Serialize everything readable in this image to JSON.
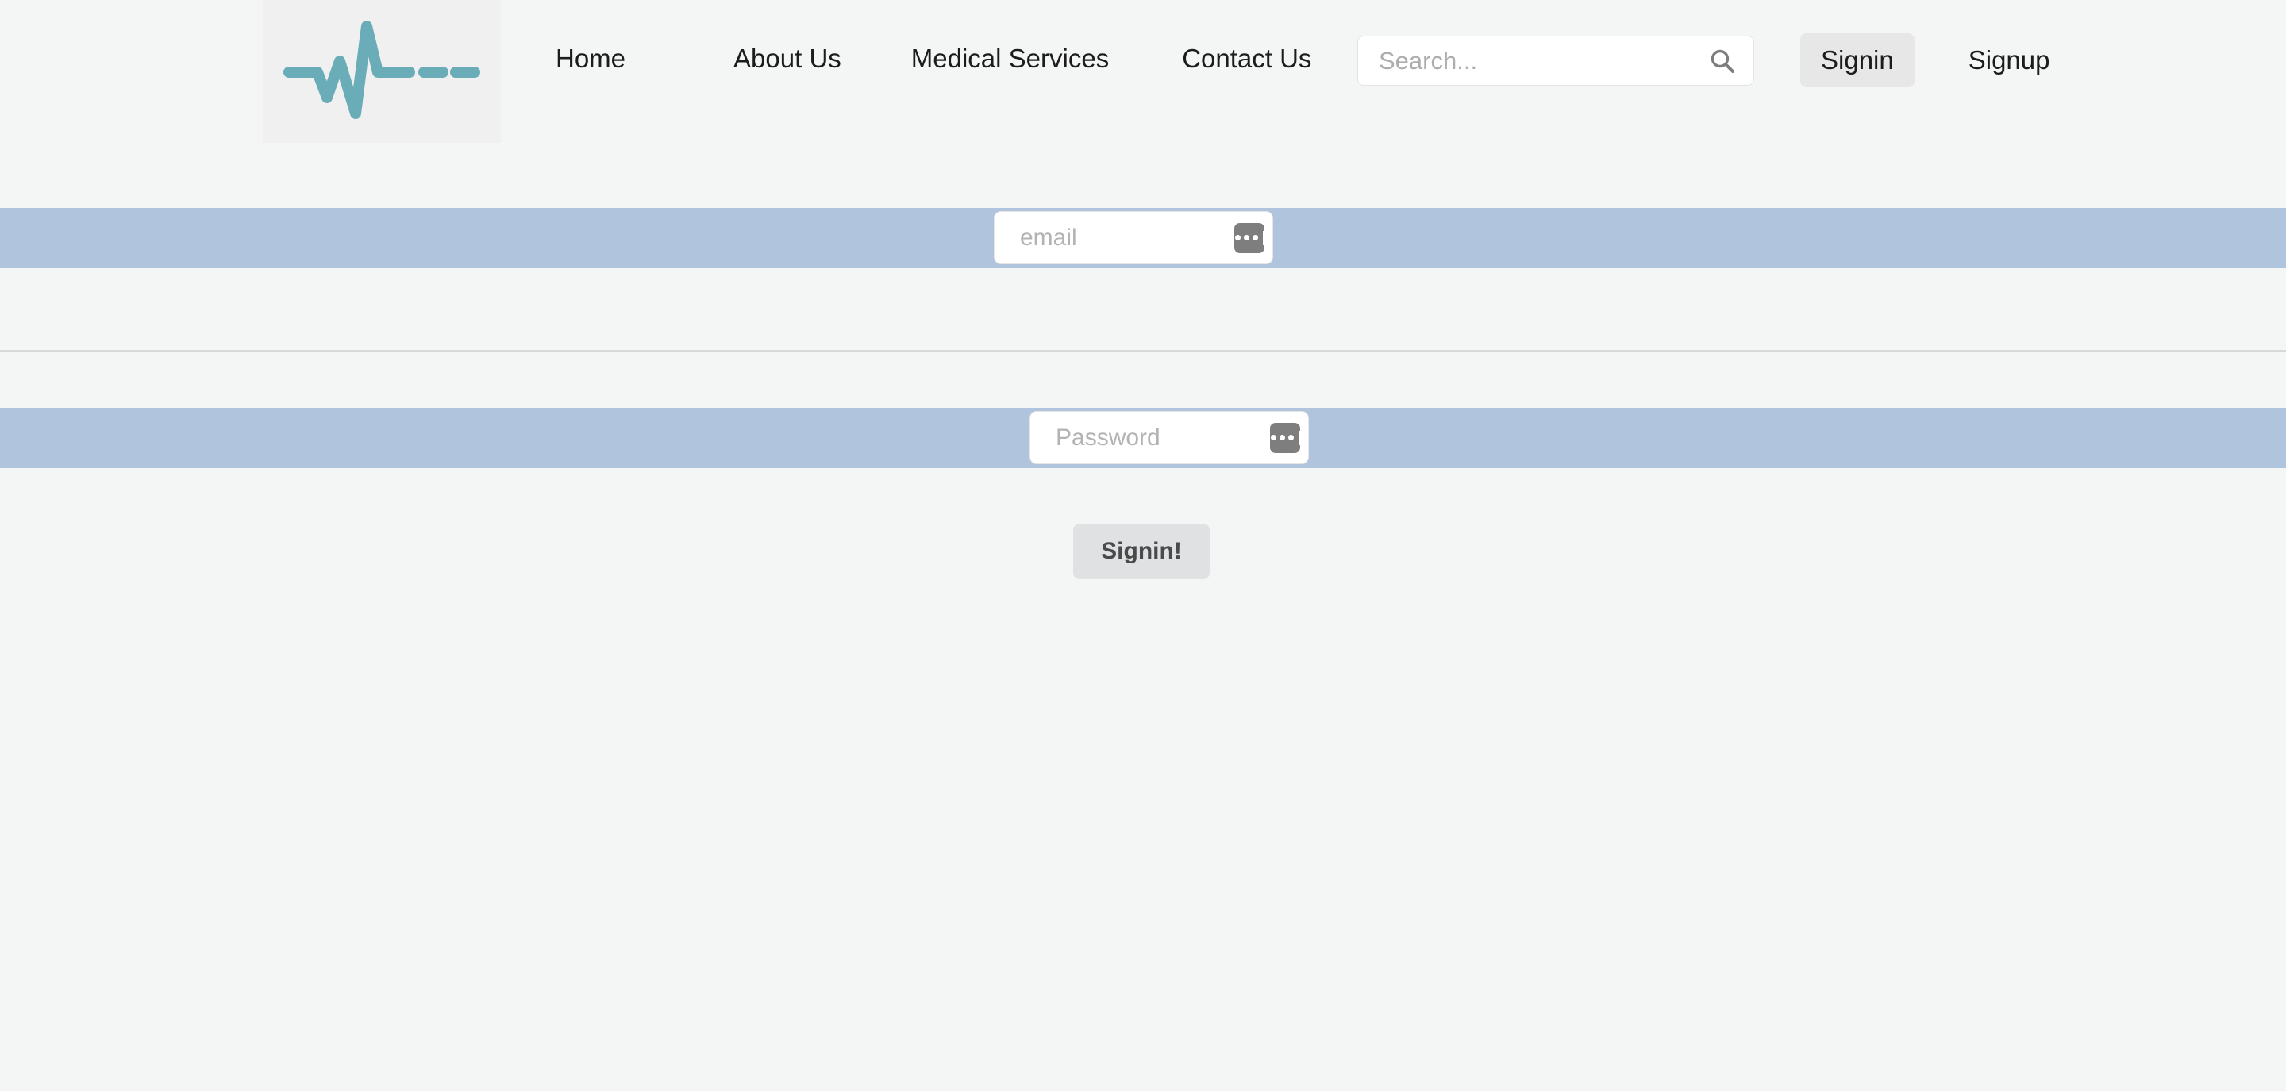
{
  "header": {
    "logo": {
      "name": "heartbeat-ekg-logo",
      "color": "#6aadb8",
      "background": "#f0f0f0"
    },
    "nav": [
      {
        "label": "Home"
      },
      {
        "label": "About Us"
      },
      {
        "label": "Medical Services"
      },
      {
        "label": "Contact Us"
      }
    ],
    "search": {
      "placeholder": "Search...",
      "value": "",
      "icon": "search-icon"
    },
    "auth": {
      "signin_label": "Signin",
      "signup_label": "Signup",
      "active": "Signin"
    }
  },
  "form": {
    "email": {
      "placeholder": "email",
      "value": "",
      "band_color": "#b0c4de",
      "autofill_icon": "autofill-dots-icon"
    },
    "password": {
      "placeholder": "Password",
      "value": "",
      "band_color": "#b0c4de",
      "autofill_icon": "autofill-dots-icon"
    },
    "submit": {
      "label": "Signin!"
    }
  },
  "theme": {
    "page_background": "#f4f5f5",
    "band_blue": "#b0c4de",
    "accent_teal": "#6aadb8",
    "divider": "#d8d8d8"
  }
}
